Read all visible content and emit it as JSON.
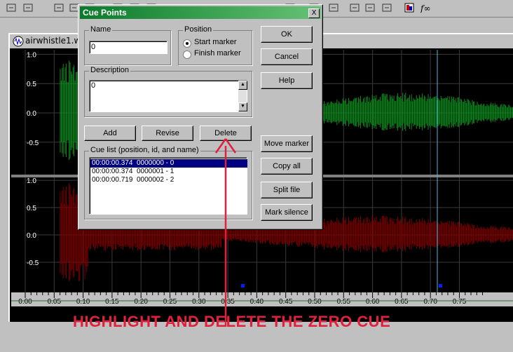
{
  "toolbar": {
    "icons": [
      "crop-icon",
      "mute-icon",
      "trim-left-icon",
      "trim-right-icon",
      "split-icon",
      "join-icon",
      "align-icon",
      "marker-icon",
      "zoom-icon",
      "grid-icon",
      "fit-icon",
      "envelope-icon",
      "view-icon",
      "preview-icon",
      "plugin-icon",
      "function-icon"
    ]
  },
  "document": {
    "title": "airwhistle1.w",
    "y_labels_top": [
      "1.0",
      "0.5",
      "0.0",
      "-0.5"
    ],
    "y_labels_bottom": [
      "1.0",
      "0.5",
      "0.0",
      "-0.5"
    ],
    "x_labels": [
      "0.00",
      "0.05",
      "0.10",
      "0.15",
      "0.20",
      "0.25",
      "0.30",
      "0.35",
      "0.40",
      "0.45",
      "0.50",
      "0.55",
      "0.60",
      "0.65",
      "0.70",
      "0.75"
    ],
    "colors": {
      "left_channel": "#0f8a1e",
      "right_channel": "#7a0000",
      "cursor": "#3fbfe0",
      "background": "#000000"
    }
  },
  "dialog": {
    "title": "Cue Points",
    "close_label": "X",
    "name_label": "Name",
    "name_value": "0",
    "position_label": "Position",
    "position_options": [
      "Start marker",
      "Finish marker"
    ],
    "position_selected": "Start marker",
    "description_label": "Description",
    "description_value": "0",
    "buttons": {
      "ok": "OK",
      "cancel": "Cancel",
      "help": "Help",
      "add": "Add",
      "revise": "Revise",
      "delete": "Delete",
      "move_marker": "Move marker",
      "copy_all": "Copy all",
      "split_file": "Split file",
      "mark_silence": "Mark silence"
    },
    "cue_list_label": "Cue list (position, id, and name)",
    "cue_list": [
      "00:00:00.374  0000000 - 0",
      "00:00:00.374  0000001 - 1",
      "00:00:00.719  0000002 - 2"
    ],
    "selected_index": 0
  },
  "annotation": {
    "text": "HIGHLIGHT AND DELETE THE ZERO CUE",
    "color": "#e0203c"
  }
}
